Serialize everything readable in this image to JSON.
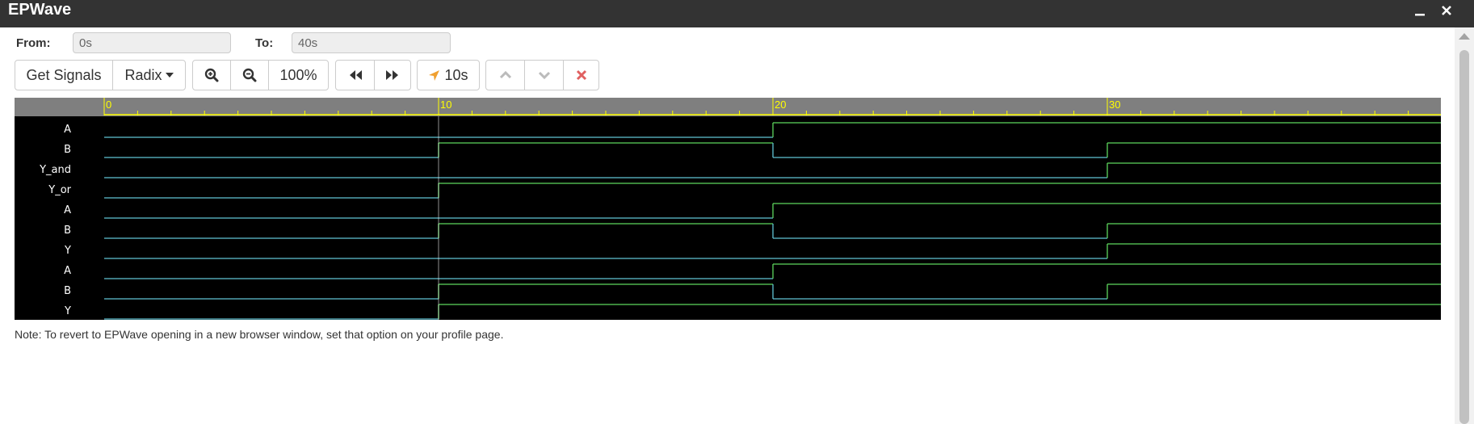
{
  "window": {
    "title": "EPWave",
    "minimize_icon": "minimize-icon",
    "close_icon": "close-icon"
  },
  "range": {
    "from_label": "From:",
    "from_value": "0s",
    "to_label": "To:",
    "to_value": "40s"
  },
  "toolbar": {
    "get_signals": "Get Signals",
    "radix": "Radix",
    "zoom_level": "100%",
    "cursor_time": "10s",
    "icons": [
      "zoom-in-icon",
      "zoom-out-icon",
      "fast-backward-icon",
      "fast-forward-icon",
      "location-arrow-icon",
      "chevron-up-icon",
      "chevron-down-icon",
      "remove-icon"
    ]
  },
  "timeline": {
    "start": 0,
    "end": 40,
    "ticks": [
      0,
      10,
      20,
      30
    ],
    "tick_labels": [
      "0",
      "10",
      "20",
      "30"
    ]
  },
  "signals": [
    {
      "name": "A",
      "transitions": [
        [
          0,
          0
        ],
        [
          20,
          1
        ]
      ]
    },
    {
      "name": "B",
      "transitions": [
        [
          0,
          0
        ],
        [
          10,
          1
        ],
        [
          20,
          0
        ],
        [
          30,
          1
        ]
      ]
    },
    {
      "name": "Y_and",
      "transitions": [
        [
          0,
          0
        ],
        [
          30,
          1
        ]
      ]
    },
    {
      "name": "Y_or",
      "transitions": [
        [
          0,
          0
        ],
        [
          10,
          1
        ]
      ]
    },
    {
      "name": "A",
      "transitions": [
        [
          0,
          0
        ],
        [
          20,
          1
        ]
      ]
    },
    {
      "name": "B",
      "transitions": [
        [
          0,
          0
        ],
        [
          10,
          1
        ],
        [
          20,
          0
        ],
        [
          30,
          1
        ]
      ]
    },
    {
      "name": "Y",
      "transitions": [
        [
          0,
          0
        ],
        [
          30,
          1
        ]
      ]
    },
    {
      "name": "A",
      "transitions": [
        [
          0,
          0
        ],
        [
          10,
          0
        ],
        [
          20,
          1
        ]
      ]
    },
    {
      "name": "B",
      "transitions": [
        [
          0,
          0
        ],
        [
          10,
          1
        ],
        [
          20,
          0
        ],
        [
          30,
          1
        ]
      ]
    },
    {
      "name": "Y",
      "transitions": [
        [
          0,
          0
        ],
        [
          10,
          1
        ]
      ]
    }
  ],
  "colors": {
    "low": "#5fc4d4",
    "high": "#5cd65c",
    "ruler_text": "#ffff00",
    "ruler_bg": "#7f7f7f",
    "cursor_icon": "#f0a030",
    "remove_icon": "#e06060"
  },
  "note": "Note: To revert to EPWave opening in a new browser window, set that option on your profile page."
}
